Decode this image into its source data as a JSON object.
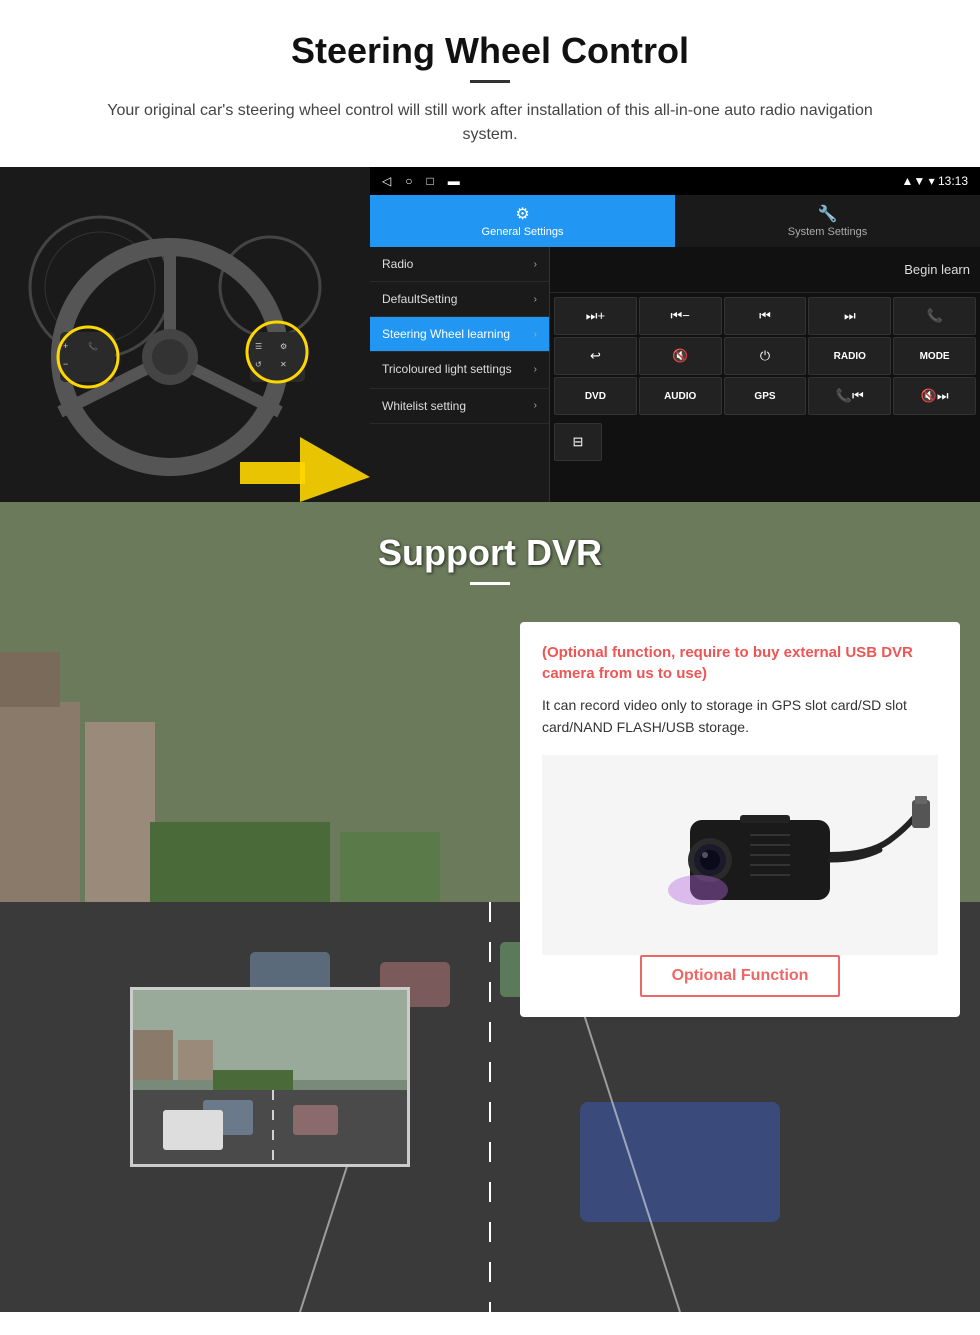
{
  "steering_section": {
    "title": "Steering Wheel Control",
    "subtitle": "Your original car's steering wheel control will still work after installation of this all-in-one auto radio navigation system.",
    "android_ui": {
      "topbar_time": "13:13",
      "tab_general": "General Settings",
      "tab_system": "System Settings",
      "menu_items": [
        {
          "label": "Radio",
          "active": false
        },
        {
          "label": "DefaultSetting",
          "active": false
        },
        {
          "label": "Steering Wheel learning",
          "active": true
        },
        {
          "label": "Tricoloured light settings",
          "active": false
        },
        {
          "label": "Whitelist setting",
          "active": false
        }
      ],
      "begin_learn": "Begin learn",
      "control_buttons": [
        "⏭+",
        "⏮−",
        "⏮⏮",
        "⏭⏭",
        "📞",
        "↩",
        "🔇",
        "⏻",
        "RADIO",
        "MODE",
        "DVD",
        "AUDIO",
        "GPS",
        "📞⏮",
        "🔇⏭"
      ],
      "bottom_icon": "⊟"
    }
  },
  "dvr_section": {
    "title": "Support DVR",
    "optional_text": "(Optional function, require to buy external USB DVR camera from us to use)",
    "description": "It can record video only to storage in GPS slot card/SD slot card/NAND FLASH/USB storage.",
    "optional_button_label": "Optional Function"
  }
}
